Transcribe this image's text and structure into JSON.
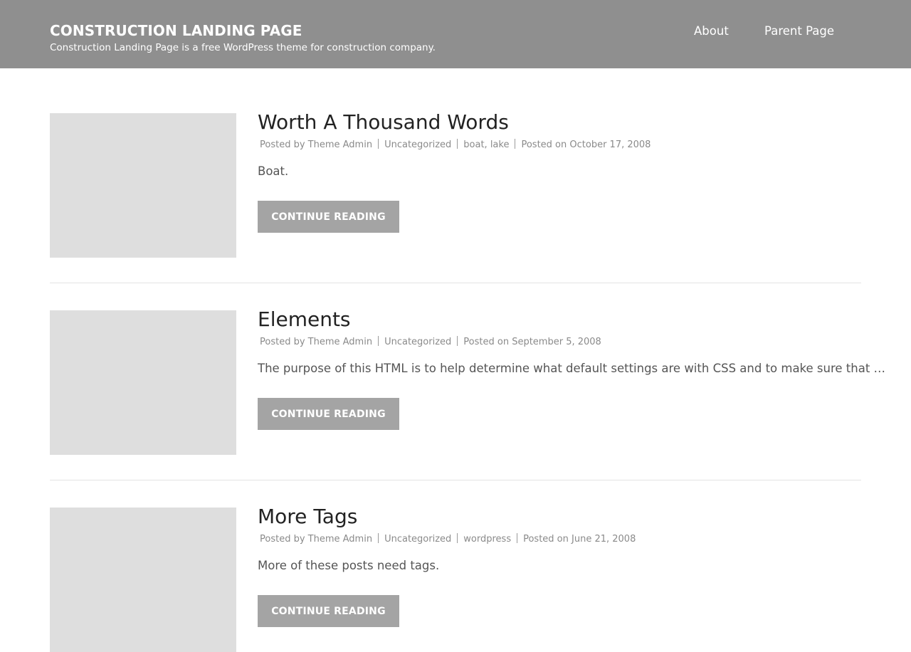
{
  "header": {
    "site_title": "CONSTRUCTION LANDING PAGE",
    "site_description": "Construction Landing Page is a free WordPress theme for construction company.",
    "nav": [
      {
        "label": "About"
      },
      {
        "label": "Parent Page"
      }
    ]
  },
  "posts": [
    {
      "title": "Worth A Thousand Words",
      "posted_by_label": "Posted by",
      "author": "Theme Admin",
      "category": "Uncategorized",
      "tags": "boat, lake",
      "posted_on_label": "Posted on",
      "date": "October 17, 2008",
      "excerpt": "Boat.",
      "button": "CONTINUE READING"
    },
    {
      "title": "Elements",
      "posted_by_label": "Posted by",
      "author": "Theme Admin",
      "category": "Uncategorized",
      "posted_on_label": "Posted on",
      "date": "September 5, 2008",
      "excerpt": "The purpose of this HTML is to help determine what default settings are with CSS and to make sure that …",
      "button": "CONTINUE READING"
    },
    {
      "title": "More Tags",
      "posted_by_label": "Posted by",
      "author": "Theme Admin",
      "category": "Uncategorized",
      "tags": "wordpress",
      "posted_on_label": "Posted on",
      "date": "June 21, 2008",
      "excerpt": "More of these posts need tags.",
      "button": "CONTINUE READING"
    }
  ]
}
